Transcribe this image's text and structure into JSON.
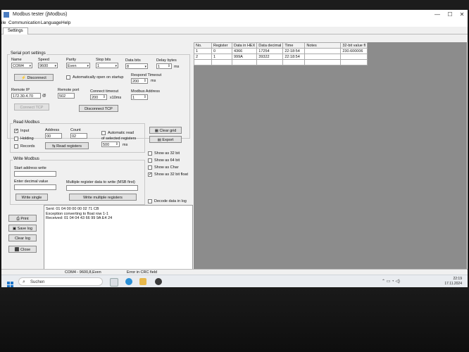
{
  "window": {
    "title": "Modbus tester (jModbus)",
    "min": "—",
    "max": "☐",
    "close": "✕"
  },
  "menu": {
    "items": [
      "ile",
      "Communication",
      "Language",
      "Help"
    ]
  },
  "tabs": {
    "settings": "Settings"
  },
  "serial": {
    "group_title": "Serial port settings",
    "name_label": "Name",
    "name_value": "COM4",
    "speed_label": "Speed",
    "speed_value": "9600",
    "parity_label": "Parity",
    "parity_value": "Even",
    "stop_label": "Stop bits",
    "stop_value": "1",
    "databits_label": "Data bits",
    "databits_value": "8",
    "delay_label": "Delay bytes",
    "delay_value": "1",
    "delay_unit": "ms",
    "disconnect_btn": "Disconnect",
    "auto_open_label": "Automatically open on startup",
    "respond_label": "Respond Timeout",
    "respond_value": "200",
    "respond_unit": "ms"
  },
  "tcp": {
    "remote_ip_label": "Remote IP",
    "remote_ip_value": "172.30.4.70",
    "remote_port_label": "Remote port",
    "remote_port_value": "502",
    "connect_timeout_label": "Connect timeout",
    "connect_timeout_value": "200",
    "connect_timeout_unit": "x10ms",
    "modbus_addr_label": "Modbus Address",
    "modbus_addr_value": "1",
    "connect_btn": "Connect TCP",
    "disconnect_btn": "Disconnect TCP"
  },
  "read": {
    "group_title": "Read Modbus",
    "input_label": "Input",
    "holding_label": "Holding",
    "records_label": "Records",
    "address_label": "Address",
    "address_value": "00",
    "count_label": "Count",
    "count_value": "02",
    "auto_label": "Automatic read",
    "auto_label2": "of selected registers",
    "interval_value": "500",
    "interval_unit": "ms",
    "read_btn": "Read registers"
  },
  "side": {
    "clear_grid": "Clear grid",
    "export": "Export",
    "show32": "Show as 32 bit",
    "show64": "Show as 64 bit",
    "showchar": "Show as Char",
    "show32float": "Show as 32 bit float",
    "decode": "Decode data in log"
  },
  "write": {
    "group_title": "Write Modbus",
    "start_label": "Start address write",
    "decimal_label": "Enter decimal value",
    "multi_label": "Multiple register data to write (MSB first)",
    "single_btn": "Write single",
    "multi_btn": "Write multiple registers"
  },
  "logbtns": {
    "print": "Print",
    "save": "Save log",
    "clear": "Clear log",
    "close": "Close"
  },
  "log": {
    "lines": [
      "Sent: 01 04 00 00 00 02 71 CB",
      "Exception converting to float row 1-1",
      "Received: 01 04 04 43 66 99 9A E4 24"
    ]
  },
  "grid": {
    "headers": [
      "No.",
      "Register",
      "Data in HEX",
      "Data decimal",
      "Time",
      "Notes",
      "32-bit value fl"
    ],
    "rows": [
      [
        "1",
        "0",
        "4366",
        "17254",
        "22:18:54",
        "",
        "230.600006"
      ],
      [
        "2",
        "1",
        "999A",
        "39322",
        "22:18:54",
        "",
        ""
      ]
    ]
  },
  "status": {
    "port": "COM4 - 9600,8,Even",
    "msg": "Error in CRC field"
  },
  "taskbar": {
    "search": "Suchen",
    "time": "22:19",
    "date": "17.11.2024"
  }
}
